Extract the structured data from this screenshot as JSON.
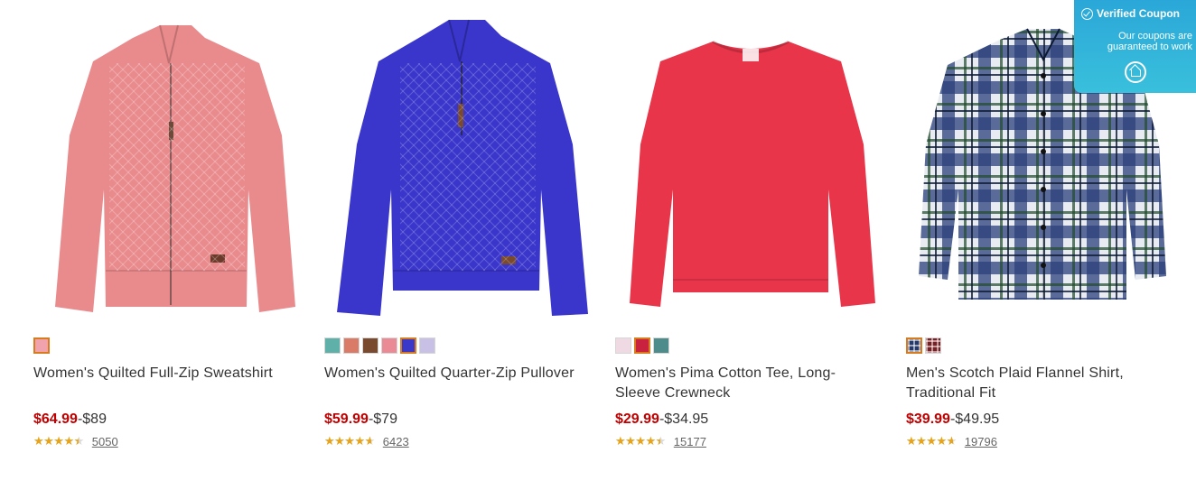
{
  "products": [
    {
      "name": "Women's Quilted Full-Zip Sweatshirt",
      "sale_price": "$64.99",
      "regular_price": "-$89",
      "rating": 4.5,
      "review_count": "5050",
      "garment_color": "#e98a8c",
      "swatches": [
        {
          "color": "#f0a3ac",
          "selected": true
        }
      ]
    },
    {
      "name": "Women's Quilted Quarter-Zip Pullover",
      "sale_price": "$59.99",
      "regular_price": "-$79",
      "rating": 4.7,
      "review_count": "6423",
      "garment_color": "#3a36cc",
      "swatches": [
        {
          "color": "#5eb0a8",
          "selected": false
        },
        {
          "color": "#d97b67",
          "selected": false
        },
        {
          "color": "#7a4a2e",
          "selected": false
        },
        {
          "color": "#e98a94",
          "selected": false
        },
        {
          "color": "#3a38c8",
          "selected": true
        },
        {
          "color": "#c9c0e6",
          "selected": false
        }
      ]
    },
    {
      "name": "Women's Pima Cotton Tee, Long-Sleeve Crewneck",
      "sale_price": "$29.99",
      "regular_price": "-$34.95",
      "rating": 4.5,
      "review_count": "15177",
      "garment_color": "#e8354a",
      "swatches": [
        {
          "color": "#efd9e2",
          "selected": false
        },
        {
          "color": "#c8223e",
          "selected": true
        },
        {
          "color": "#4e8c8c",
          "selected": false
        }
      ]
    },
    {
      "name": "Men's Scotch Plaid Flannel Shirt, Traditional Fit",
      "sale_price": "$39.99",
      "regular_price": "-$49.95",
      "rating": 4.7,
      "review_count": "19796",
      "garment_color": "#2a3f7a",
      "swatches": [
        {
          "color": "#243a6b",
          "selected": true,
          "plaid": true
        },
        {
          "color": "#7a1e24",
          "selected": false,
          "plaid": true
        }
      ]
    }
  ],
  "coupon": {
    "title": "Verified Coupon",
    "subtitle": "Our coupons are guaranteed to work"
  }
}
